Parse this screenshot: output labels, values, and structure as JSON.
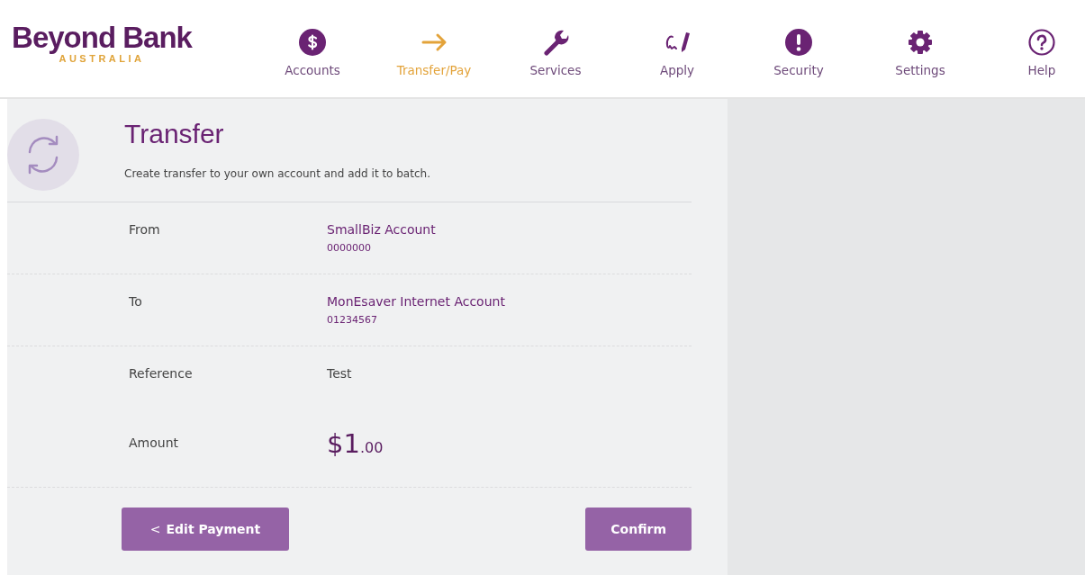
{
  "logo": {
    "name": "Beyond Bank",
    "tagline": "AUSTRALIA"
  },
  "nav": [
    {
      "label": "Accounts",
      "selected": false
    },
    {
      "label": "Transfer/Pay",
      "selected": true
    },
    {
      "label": "Services",
      "selected": false
    },
    {
      "label": "Apply",
      "selected": false
    },
    {
      "label": "Security",
      "selected": false
    },
    {
      "label": "Settings",
      "selected": false
    },
    {
      "label": "Help",
      "selected": false
    }
  ],
  "page": {
    "title": "Transfer",
    "subtitle": "Create transfer to your own account and add it to batch."
  },
  "details": [
    {
      "kind": "account",
      "label": "From",
      "value": "SmallBiz Account",
      "number": "0000000"
    },
    {
      "kind": "account",
      "label": "To",
      "value": "MonEsaver Internet Account",
      "number": "01234567"
    },
    {
      "kind": "text",
      "label": "Reference",
      "value": "Test"
    },
    {
      "kind": "amount",
      "label": "Amount",
      "value": "$1",
      "cents": ".00"
    }
  ],
  "buttons": {
    "back": "Edit Payment",
    "back_icon": "<",
    "confirm": "Confirm"
  }
}
